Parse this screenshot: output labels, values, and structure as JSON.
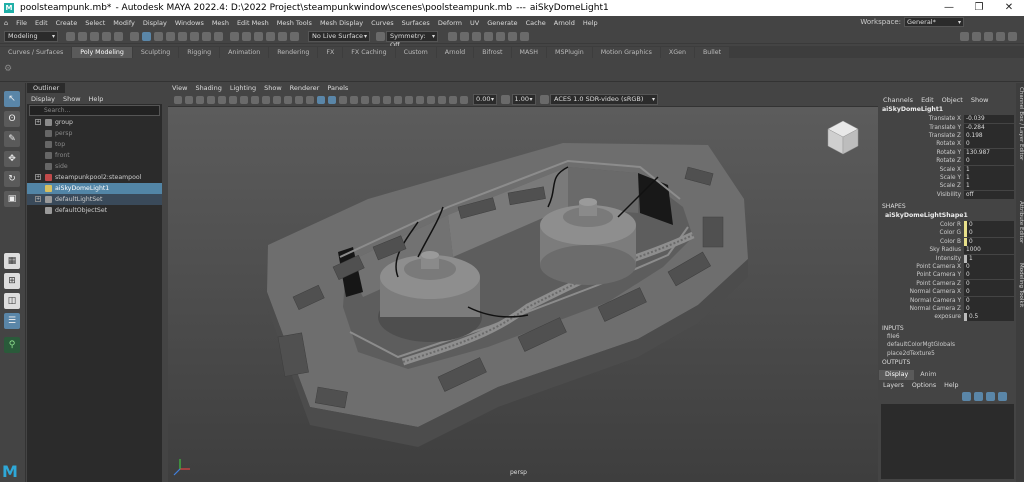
{
  "window": {
    "title_file": "poolsteampunk.mb*",
    "title_app": "- Autodesk MAYA 2022.4: D:\\2022 Project\\steampunkwindow\\scenes\\poolsteampunk.mb",
    "title_sep": "---",
    "title_node": "aiSkyDomeLight1",
    "min": "—",
    "max": "❐",
    "close": "✕"
  },
  "menubar": {
    "items": [
      "File",
      "Edit",
      "Create",
      "Select",
      "Modify",
      "Display",
      "Windows",
      "Mesh",
      "Edit Mesh",
      "Mesh Tools",
      "Mesh Display",
      "Curves",
      "Surfaces",
      "Deform",
      "UV",
      "Generate",
      "Cache",
      "Arnold",
      "Help"
    ],
    "workspace_label": "Workspace:",
    "workspace_value": "General*"
  },
  "statusline": {
    "mode": "Modeling",
    "live_surface": "No Live Surface",
    "symmetry": "Symmetry: Off"
  },
  "shelf": {
    "tabs": [
      "Curves / Surfaces",
      "Poly Modeling",
      "Sculpting",
      "Rigging",
      "Animation",
      "Rendering",
      "FX",
      "FX Caching",
      "Custom",
      "Arnold",
      "Bifrost",
      "MASH",
      "MSPlugin",
      "Motion Graphics",
      "XGen",
      "Bullet"
    ],
    "active_index": 1
  },
  "outliner": {
    "tab": "Outliner",
    "menu": [
      "Display",
      "Show",
      "Help"
    ],
    "search_placeholder": "Search...",
    "rows": [
      {
        "label": "group",
        "style": "normal",
        "indent": 18,
        "expand": true,
        "icon": "#8a8a8a"
      },
      {
        "label": "persp",
        "style": "dim",
        "indent": 18,
        "expand": false,
        "icon": "#666"
      },
      {
        "label": "top",
        "style": "dim",
        "indent": 18,
        "expand": false,
        "icon": "#666"
      },
      {
        "label": "front",
        "style": "dim",
        "indent": 18,
        "expand": false,
        "icon": "#666"
      },
      {
        "label": "side",
        "style": "dim",
        "indent": 18,
        "expand": false,
        "icon": "#666"
      },
      {
        "label": "steampunkpool2:steampool",
        "style": "normal",
        "indent": 18,
        "expand": true,
        "icon": "#c04a4a"
      },
      {
        "label": "aiSkyDomeLight1",
        "style": "sel",
        "indent": 18,
        "expand": false,
        "icon": "#d8c060"
      },
      {
        "label": "defaultLightSet",
        "style": "hl",
        "indent": 18,
        "expand": true,
        "icon": "#9a9a9a"
      },
      {
        "label": "defaultObjectSet",
        "style": "normal",
        "indent": 18,
        "expand": false,
        "icon": "#9a9a9a"
      }
    ]
  },
  "viewport": {
    "menu": [
      "View",
      "Shading",
      "Lighting",
      "Show",
      "Renderer",
      "Panels"
    ],
    "val1": "0.00",
    "val2": "1.00",
    "colorspace": "ACES 1.0 SDR-video (sRGB)",
    "camera": "persp"
  },
  "channelbox": {
    "menu": [
      "Channels",
      "Edit",
      "Object",
      "Show"
    ],
    "node": "aiSkyDomeLight1",
    "attrs": [
      {
        "name": "Translate X",
        "value": "-0.039"
      },
      {
        "name": "Translate Y",
        "value": "-0.284"
      },
      {
        "name": "Translate Z",
        "value": "0.198"
      },
      {
        "name": "Rotate X",
        "value": "0"
      },
      {
        "name": "Rotate Y",
        "value": "130.987"
      },
      {
        "name": "Rotate Z",
        "value": "0"
      },
      {
        "name": "Scale X",
        "value": "1"
      },
      {
        "name": "Scale Y",
        "value": "1"
      },
      {
        "name": "Scale Z",
        "value": "1"
      },
      {
        "name": "Visibility",
        "value": "off"
      }
    ],
    "shapes_label": "SHAPES",
    "shape_node": "aiSkyDomeLightShape1",
    "shape_attrs": [
      {
        "name": "Color R",
        "value": "0",
        "swatch": "#e8e08a"
      },
      {
        "name": "Color G",
        "value": "0",
        "swatch": "#e8e08a"
      },
      {
        "name": "Color B",
        "value": "0",
        "swatch": "#e8e08a"
      },
      {
        "name": "Sky Radius",
        "value": "1000",
        "swatch": ""
      },
      {
        "name": "Intensity",
        "value": "1",
        "swatch": "#bbbbbb"
      },
      {
        "name": "Point Camera X",
        "value": "0",
        "swatch": ""
      },
      {
        "name": "Point Camera Y",
        "value": "0",
        "swatch": ""
      },
      {
        "name": "Point Camera Z",
        "value": "0",
        "swatch": ""
      },
      {
        "name": "Normal Camera X",
        "value": "0",
        "swatch": ""
      },
      {
        "name": "Normal Camera Y",
        "value": "0",
        "swatch": ""
      },
      {
        "name": "Normal Camera Z",
        "value": "0",
        "swatch": ""
      },
      {
        "name": "exposure",
        "value": "0.5",
        "swatch": "#bbbbbb"
      }
    ],
    "inputs_label": "INPUTS",
    "inputs": [
      "file6",
      "defaultColorMgtGlobals",
      "place2dTexture5"
    ],
    "outputs_label": "OUTPUTS"
  },
  "displaylayer": {
    "tabs": [
      "Display",
      "Anim"
    ],
    "menu": [
      "Layers",
      "Options",
      "Help"
    ]
  },
  "sidetabs": [
    "Channel Box / Layer Editor",
    "Attribute Editor",
    "Modeling Toolkit"
  ],
  "logo": "M"
}
